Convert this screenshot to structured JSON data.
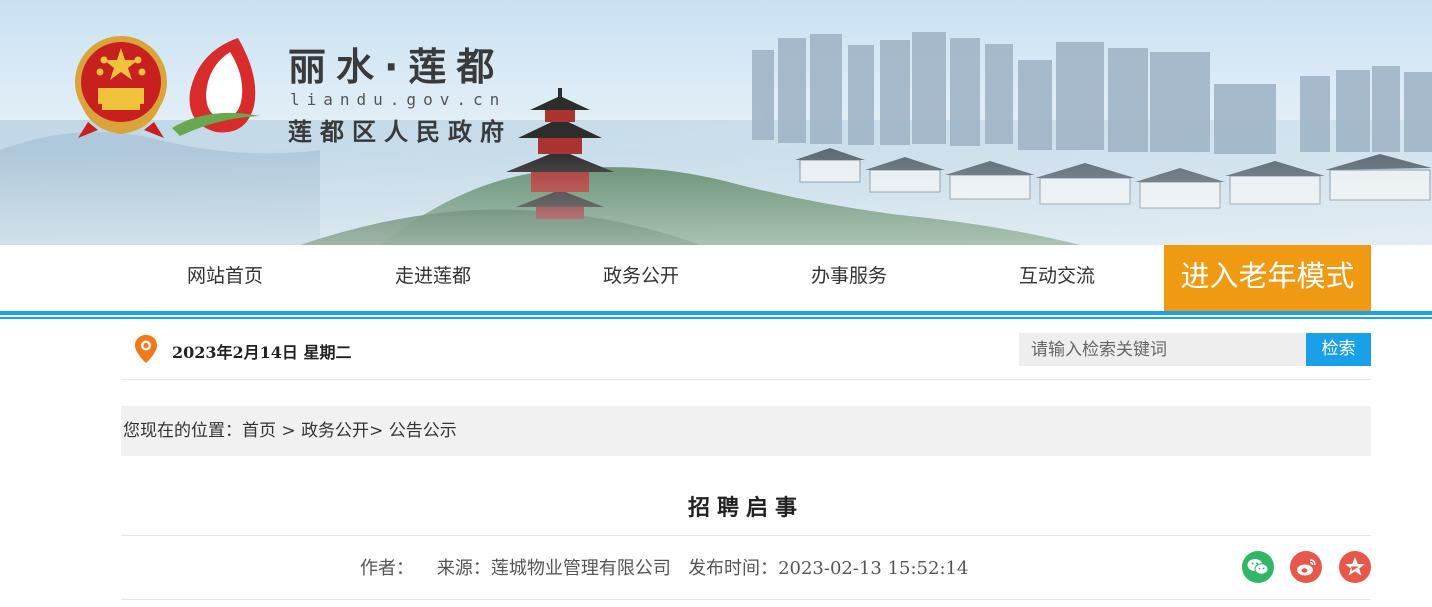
{
  "header": {
    "title": "丽水·莲都",
    "domain": "liandu.gov.cn",
    "subtitle": "莲都区人民政府",
    "emblem_icon": "national-emblem-icon",
    "logo_icon": "liandu-logo-icon"
  },
  "nav": {
    "items": [
      {
        "label": "网站首页"
      },
      {
        "label": "走进莲都"
      },
      {
        "label": "政务公开"
      },
      {
        "label": "办事服务"
      },
      {
        "label": "互动交流"
      }
    ],
    "elder_mode_label": "进入老年模式"
  },
  "infobar": {
    "date": "2023年2月14日 星期二",
    "search_placeholder": "请输入检索关键词",
    "search_button": "检索"
  },
  "breadcrumb": {
    "prefix": "您现在的位置：",
    "home": "首页",
    "sep1": " > ",
    "section": "政务公开",
    "sep2": "> ",
    "current": "公告公示"
  },
  "article": {
    "title": "招聘启事",
    "author_label": "作者：",
    "author": "",
    "source_label": "来源：",
    "source": "莲城物业管理有限公司",
    "time_label": "发布时间：",
    "time": "2023-02-13 15:52:14"
  },
  "share": {
    "icons": [
      "wechat-icon",
      "weibo-icon",
      "qzone-icon"
    ]
  },
  "colors": {
    "accent_blue": "#1aa0e8",
    "elder_orange": "#f09a14",
    "wechat_green": "#2fb766",
    "share_red": "#e8584a"
  }
}
